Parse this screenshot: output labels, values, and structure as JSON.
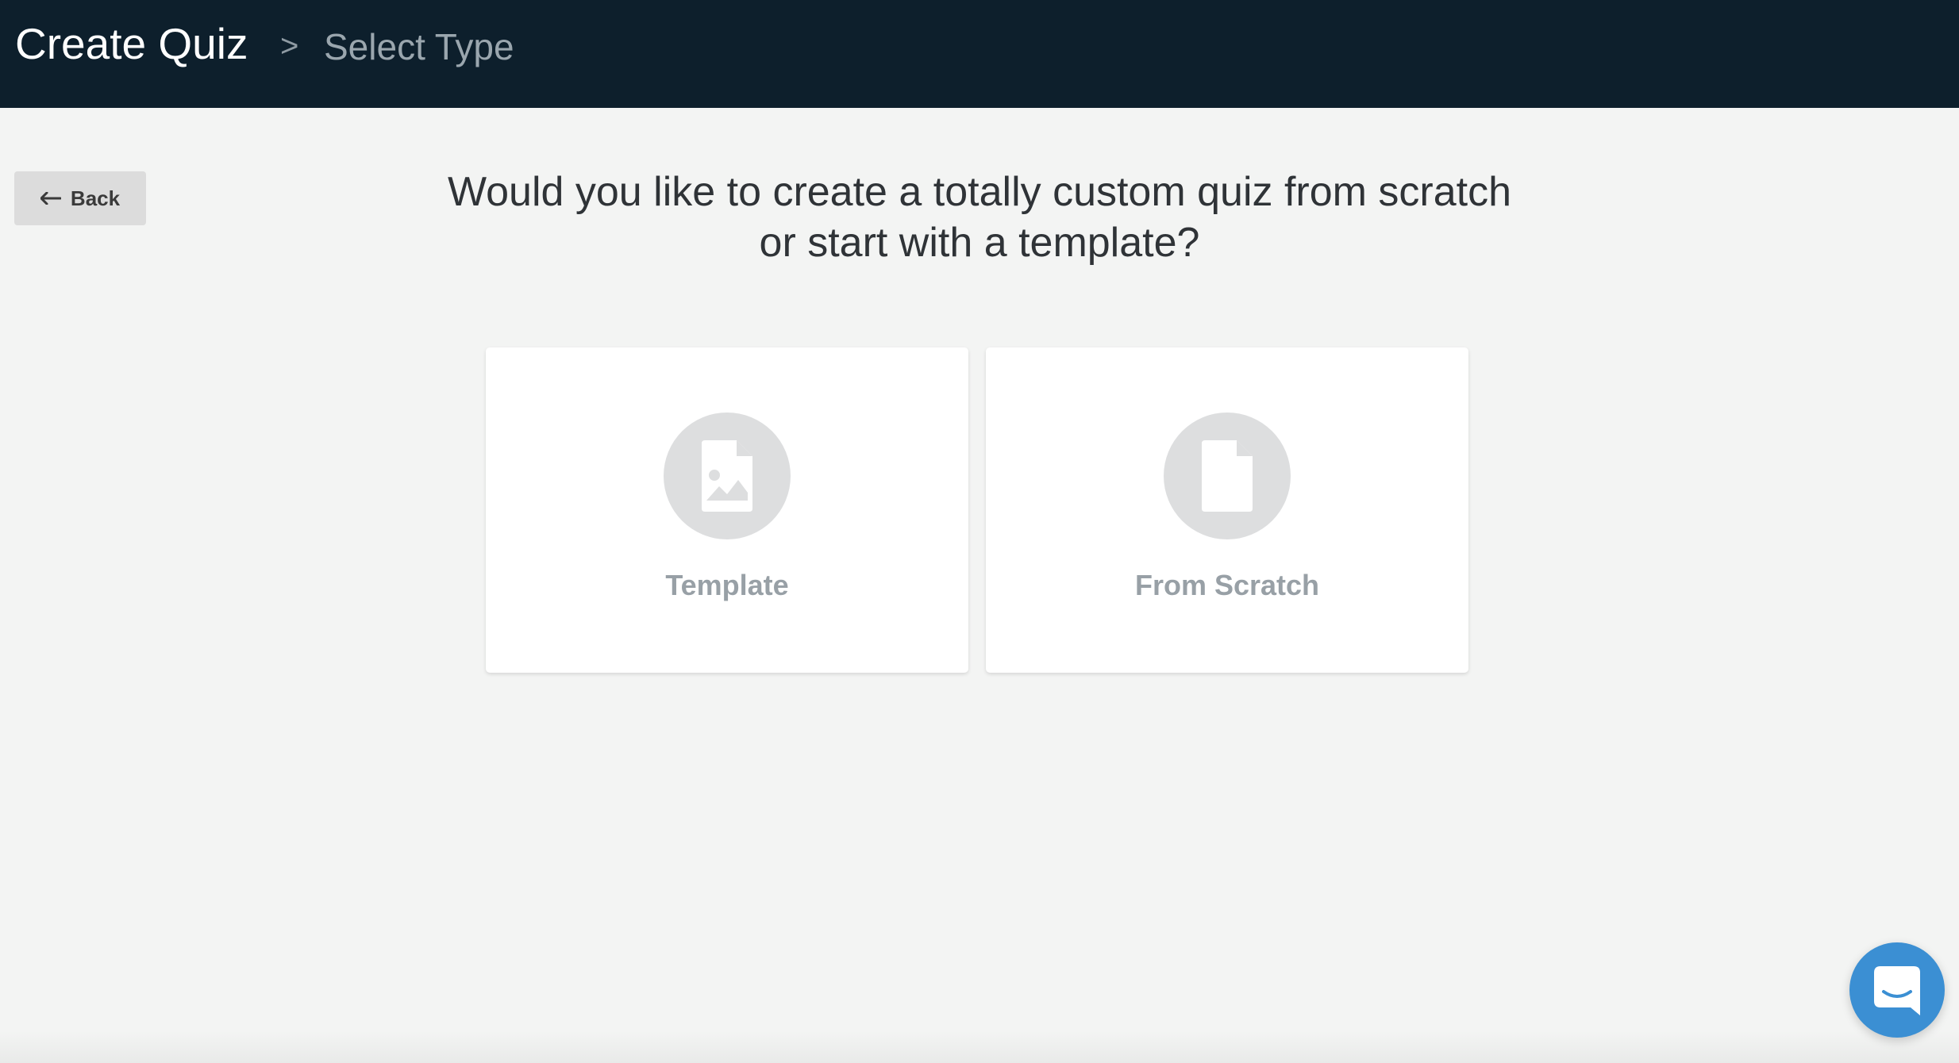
{
  "header": {
    "title": "Create Quiz",
    "separator": ">",
    "current_step": "Select Type"
  },
  "back_button": {
    "label": "Back",
    "icon": "arrow-left-icon"
  },
  "main": {
    "question_line1": "Would you like to create a totally custom quiz from scratch",
    "question_line2": "or start with a template?"
  },
  "options": [
    {
      "label": "Template",
      "icon": "image-file-icon"
    },
    {
      "label": "From Scratch",
      "icon": "blank-file-icon"
    }
  ],
  "chat": {
    "icon": "chat-bubble-icon"
  },
  "colors": {
    "header_bg": "#0d1f2c",
    "page_bg": "#f3f4f3",
    "icon_circle": "#dddedf",
    "chat_accent": "#3b8fd3"
  }
}
